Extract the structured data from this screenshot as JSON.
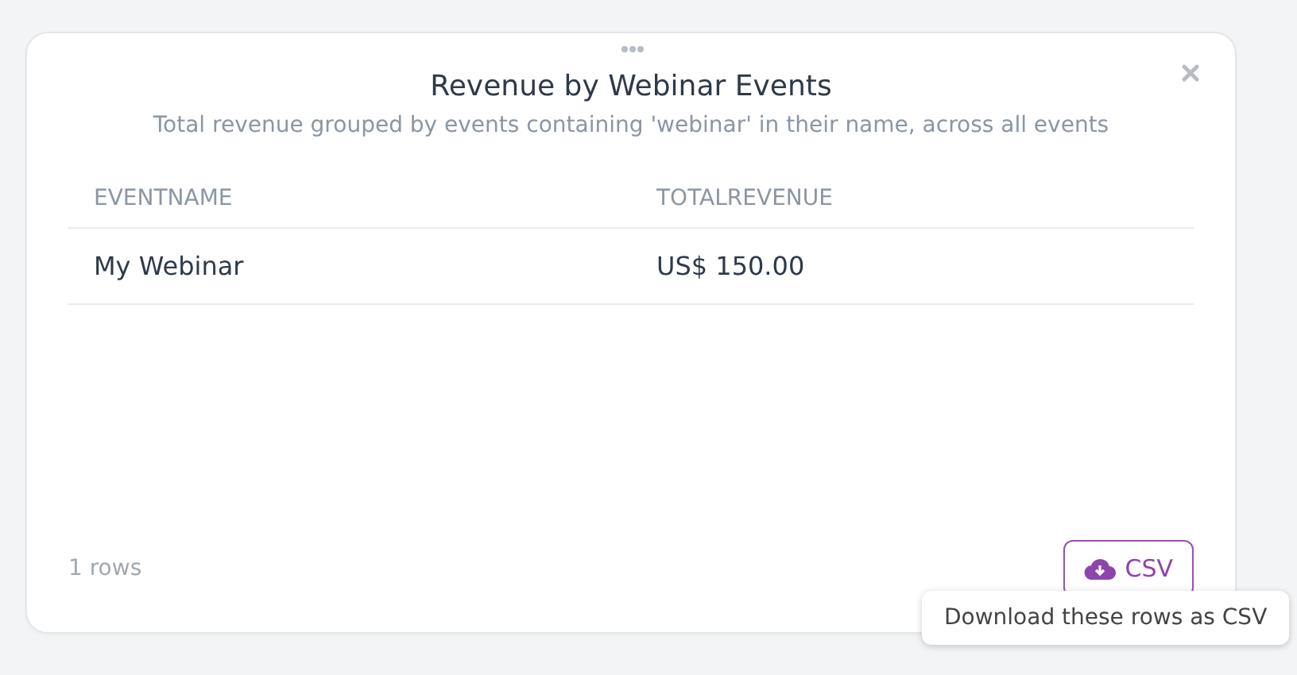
{
  "card": {
    "title": "Revenue by Webinar Events",
    "subtitle": "Total revenue grouped by events containing 'webinar' in their name, across all events"
  },
  "table": {
    "columns": [
      "EVENTNAME",
      "TOTALREVENUE"
    ],
    "rows": [
      [
        "My Webinar",
        "US$ 150.00"
      ]
    ]
  },
  "footer": {
    "row_count": "1 rows",
    "export_button": "CSV"
  },
  "tooltip": "Download these rows as CSV"
}
